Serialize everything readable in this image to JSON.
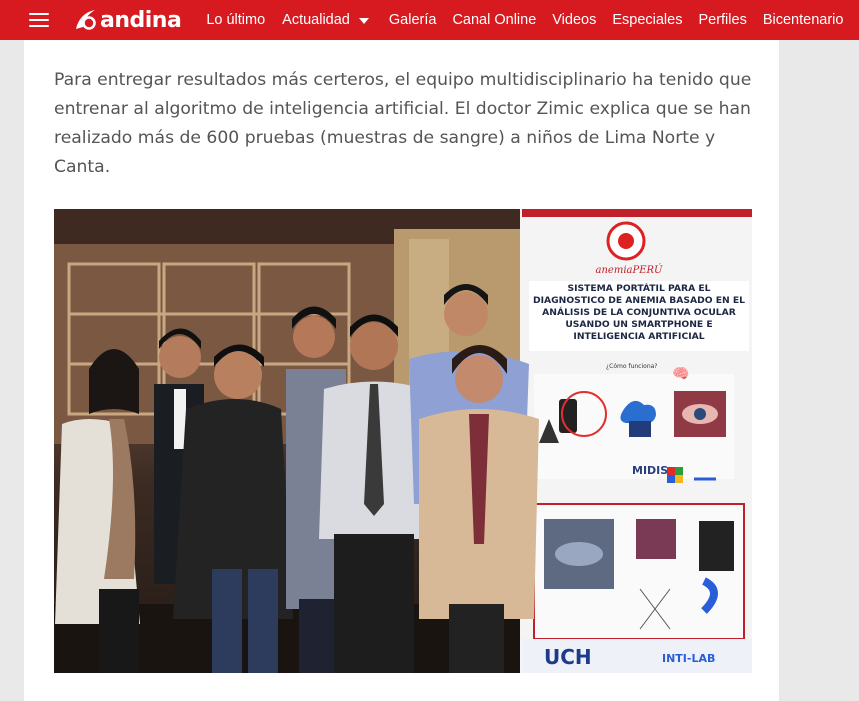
{
  "header": {
    "logo_text": "andina",
    "nav": [
      {
        "label": "Lo último"
      },
      {
        "label": "Actualidad",
        "has_dropdown": true
      },
      {
        "label": "Galería"
      },
      {
        "label": "Canal Online"
      },
      {
        "label": "Videos"
      },
      {
        "label": "Especiales"
      },
      {
        "label": "Perfiles"
      },
      {
        "label": "Bicentenario"
      }
    ],
    "accent_color": "#d71920"
  },
  "article": {
    "paragraph": "Para entregar resultados más certeros, el equipo multidisciplinario ha tenido que entrenar al algoritmo de inteligencia artificial. El doctor Zimic explica que se han realizado más de 600 pruebas (muestras de sangre) a niños de Lima Norte y Canta."
  },
  "photo": {
    "banner_brand": "anemiaPERÚ",
    "banner_title": "SISTEMA PORTÁTIL PARA EL DIAGNOSTICO DE ANEMIA BASADO EN EL ANÁLISIS DE LA CONJUNTIVA OCULAR USANDO UN SMARTPHONE E INTELIGENCIA ARTIFICIAL",
    "banner_question": "¿Cómo funciona?",
    "banner_midis": "MIDIS",
    "banner_footer_left": "UCH",
    "banner_footer_right": "INTI-LAB"
  }
}
